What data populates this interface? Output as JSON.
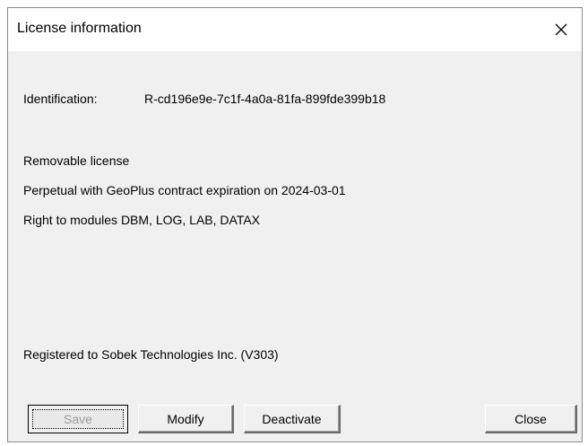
{
  "window": {
    "title": "License information",
    "close_glyph": "✕"
  },
  "license": {
    "identification_label": "Identification:",
    "identification_value": "R-cd196e9e-7c1f-4a0a-81fa-899fde399b18",
    "type": "Removable license",
    "term": "Perpetual with GeoPlus contract expiration on 2024-03-01",
    "modules": "Right to modules DBM, LOG, LAB, DATAX",
    "registered_to": "Registered to Sobek Technologies Inc. (V303)"
  },
  "buttons": {
    "save": "Save",
    "modify": "Modify",
    "deactivate": "Deactivate",
    "close": "Close"
  },
  "colors": {
    "dialog_background": "#f0f0f0",
    "disabled_text": "#9b9b9b"
  }
}
